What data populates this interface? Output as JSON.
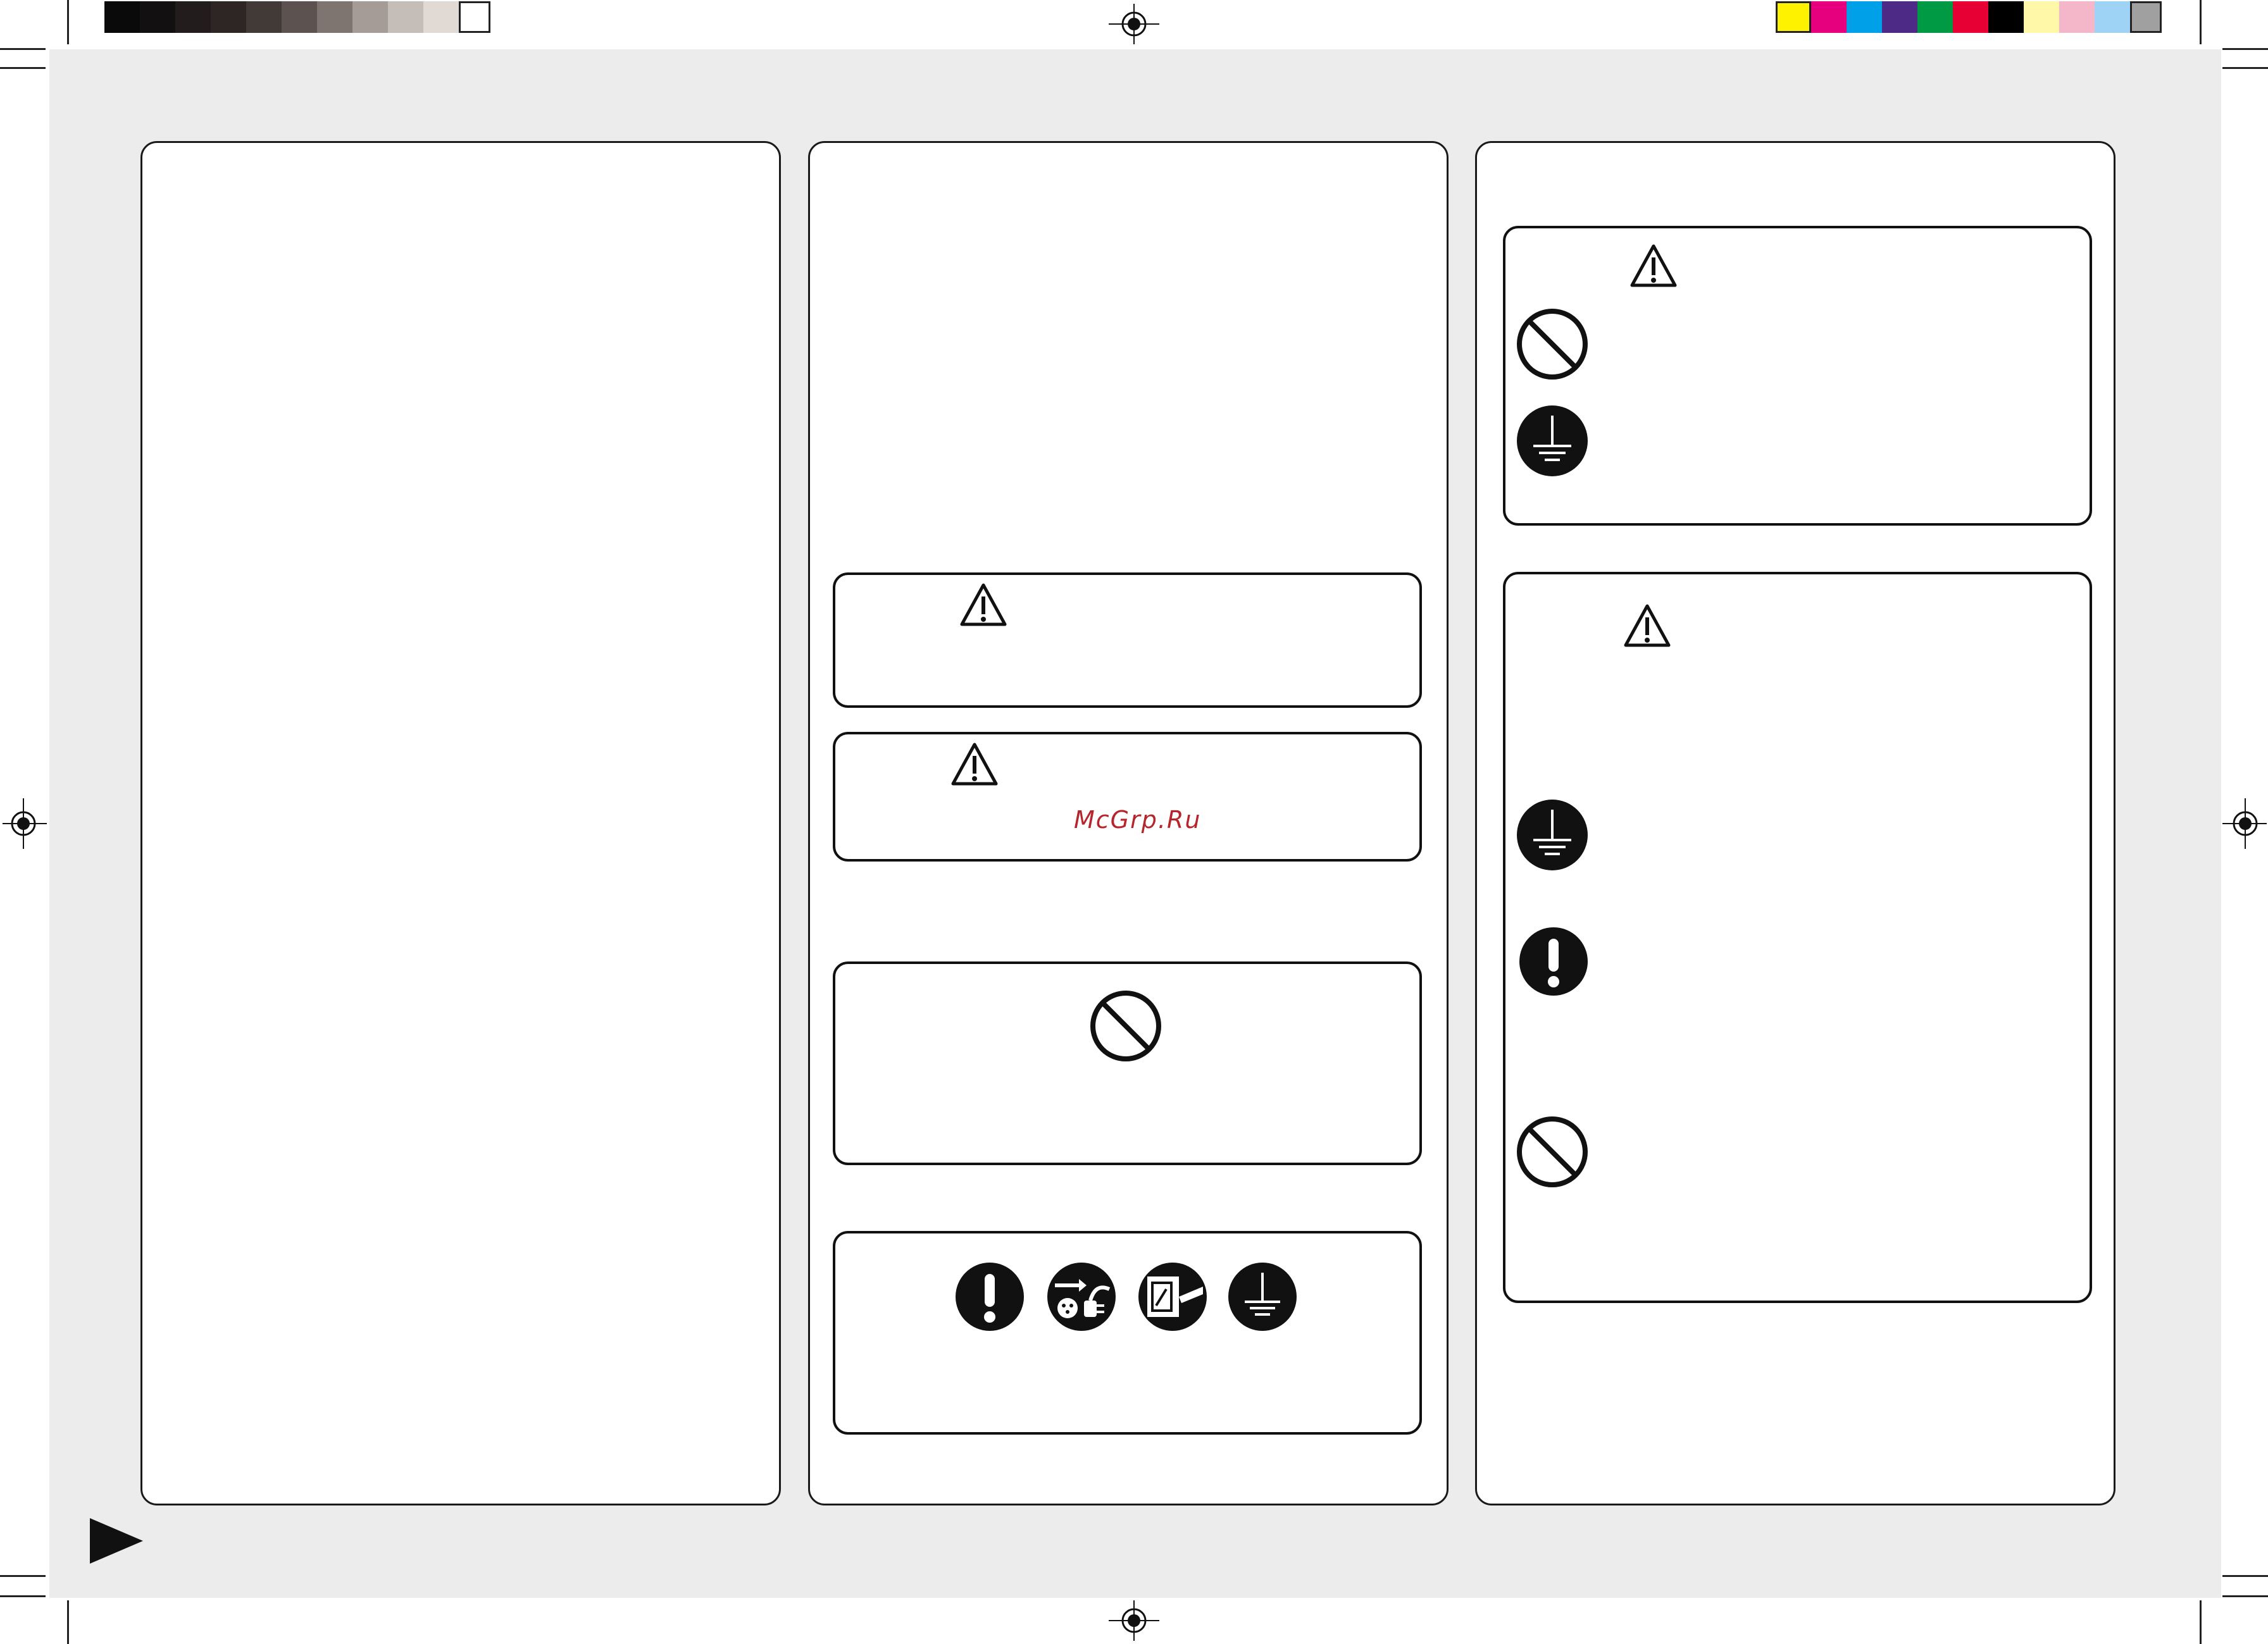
{
  "watermark": {
    "text": "McGrp.Ru"
  },
  "colors": {
    "sheet_background": "#ececec",
    "panel_border": "#1a1a1a",
    "watermark": "#b5252b",
    "gray_strip": [
      "#0a0a0a",
      "#121010",
      "#221c1c",
      "#2e2625",
      "#423a37",
      "#5c5350",
      "#7e7470",
      "#a59c97",
      "#c4bdb8",
      "#e0d9d4",
      "#ffffff"
    ],
    "color_strip": [
      "#fff200",
      "#e6007e",
      "#00a0e9",
      "#4c2a86",
      "#009944",
      "#e60033",
      "#000000",
      "#fff8a8",
      "#f4b6c9",
      "#9fd3f5",
      "#a0a0a0"
    ]
  },
  "icons": {
    "warning": "warning-triangle-icon",
    "prohibition": "prohibition-icon",
    "ground": "ground-icon",
    "mandatory": "exclamation-icon",
    "unplug": "unplug-icon",
    "breaker": "breaker-icon",
    "next_page": "next-page-arrow-icon",
    "registration": "registration-mark-icon"
  }
}
